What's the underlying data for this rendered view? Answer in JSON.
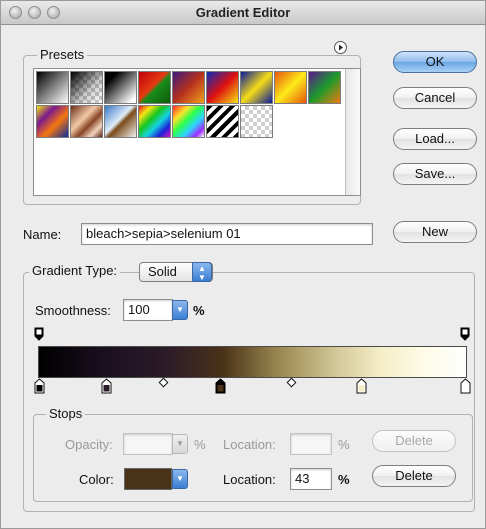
{
  "window": {
    "title": "Gradient Editor"
  },
  "presets": {
    "label": "Presets",
    "menu_icon": "circle-arrow-icon"
  },
  "buttons": {
    "ok": "OK",
    "cancel": "Cancel",
    "load": "Load...",
    "save": "Save...",
    "new": "New",
    "delete": "Delete"
  },
  "name_field": {
    "label": "Name:",
    "value": "bleach>sepia>selenium 01"
  },
  "gradient": {
    "type_label": "Gradient Type:",
    "type_value": "Solid",
    "smoothness_label": "Smoothness:",
    "smoothness_value": "100",
    "smoothness_unit": "%"
  },
  "stops": {
    "label": "Stops",
    "opacity_label": "Opacity:",
    "opacity_value": "",
    "opacity_unit": "%",
    "opacity_location_label": "Location:",
    "opacity_location_value": "",
    "opacity_location_unit": "%",
    "color_label": "Color:",
    "color_value": "#4a3218",
    "color_location_label": "Location:",
    "color_location_value": "43",
    "color_location_unit": "%"
  },
  "colors": {
    "ok_button": "#7fb2ea",
    "selected_color_stop": "#4a3218"
  }
}
